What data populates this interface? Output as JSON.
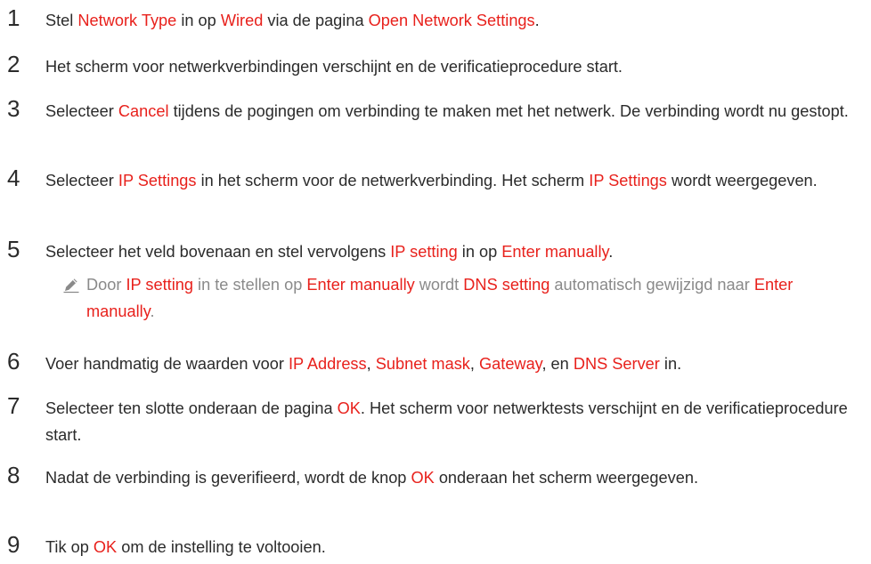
{
  "steps": [
    {
      "number": "1",
      "segments": [
        {
          "t": "Stel ",
          "h": false
        },
        {
          "t": "Network Type",
          "h": true
        },
        {
          "t": " in op ",
          "h": false
        },
        {
          "t": "Wired",
          "h": true
        },
        {
          "t": " via de pagina ",
          "h": false
        },
        {
          "t": "Open Network Settings",
          "h": true
        },
        {
          "t": ".",
          "h": false
        }
      ]
    },
    {
      "number": "2",
      "segments": [
        {
          "t": "Het scherm voor netwerkverbindingen verschijnt en de verificatieprocedure start.",
          "h": false
        }
      ]
    },
    {
      "number": "3",
      "segments": [
        {
          "t": "Selecteer ",
          "h": false
        },
        {
          "t": "Cancel",
          "h": true
        },
        {
          "t": " tijdens de pogingen om verbinding te maken met het netwerk. De verbinding wordt nu gestopt.",
          "h": false
        }
      ]
    },
    {
      "number": "4",
      "segments": [
        {
          "t": "Selecteer ",
          "h": false
        },
        {
          "t": "IP Settings",
          "h": true
        },
        {
          "t": " in het scherm voor de netwerkverbinding. Het scherm ",
          "h": false
        },
        {
          "t": "IP Settings",
          "h": true
        },
        {
          "t": " wordt weergegeven.",
          "h": false
        }
      ]
    },
    {
      "number": "5",
      "segments": [
        {
          "t": "Selecteer het veld bovenaan en stel vervolgens ",
          "h": false
        },
        {
          "t": "IP setting",
          "h": true
        },
        {
          "t": " in op ",
          "h": false
        },
        {
          "t": "Enter manually",
          "h": true
        },
        {
          "t": ".",
          "h": false
        }
      ]
    },
    {
      "number": "6",
      "segments": [
        {
          "t": "Voer handmatig de waarden voor ",
          "h": false
        },
        {
          "t": "IP Address",
          "h": true
        },
        {
          "t": ", ",
          "h": false
        },
        {
          "t": "Subnet mask",
          "h": true
        },
        {
          "t": ", ",
          "h": false
        },
        {
          "t": "Gateway",
          "h": true
        },
        {
          "t": ", en ",
          "h": false
        },
        {
          "t": "DNS Server",
          "h": true
        },
        {
          "t": " in.",
          "h": false
        }
      ]
    },
    {
      "number": "7",
      "segments": [
        {
          "t": "Selecteer ten slotte onderaan de pagina ",
          "h": false
        },
        {
          "t": "OK",
          "h": true
        },
        {
          "t": ". Het scherm voor netwerktests verschijnt en de verificatieprocedure start.",
          "h": false
        }
      ]
    },
    {
      "number": "8",
      "segments": [
        {
          "t": "Nadat de verbinding is geverifieerd, wordt de knop ",
          "h": false
        },
        {
          "t": "OK",
          "h": true
        },
        {
          "t": " onderaan het scherm weergegeven.",
          "h": false
        }
      ]
    },
    {
      "number": "9",
      "segments": [
        {
          "t": "Tik op ",
          "h": false
        },
        {
          "t": "OK",
          "h": true
        },
        {
          "t": " om de instelling te voltooien.",
          "h": false
        }
      ]
    }
  ],
  "note": {
    "icon": "pencil-icon",
    "segments": [
      {
        "t": "Door ",
        "h": false
      },
      {
        "t": "IP setting",
        "h": true
      },
      {
        "t": " in te stellen op ",
        "h": false
      },
      {
        "t": "Enter manually",
        "h": true
      },
      {
        "t": " wordt ",
        "h": false
      },
      {
        "t": "DNS setting",
        "h": true
      },
      {
        "t": " automatisch gewijzigd naar ",
        "h": false
      },
      {
        "t": "Enter manually",
        "h": true
      },
      {
        "t": ".",
        "h": false
      }
    ]
  },
  "colors": {
    "highlight": "#e8211c",
    "body_text": "#2b2b2b",
    "note_text": "#8a8a8a"
  }
}
